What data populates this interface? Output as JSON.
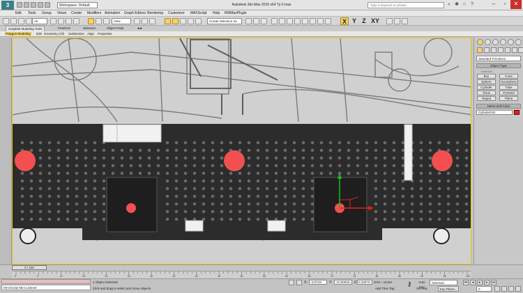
{
  "title_bar": {
    "logo_text": "3",
    "workspace": "Workspace: Default",
    "title": "Autodesk 3ds Max  2015 x64      Ty-2.max",
    "search_placeholder": "Type a keyword or phrase"
  },
  "menu": [
    "Edit",
    "Tools",
    "Group",
    "Views",
    "Create",
    "Modifiers",
    "Animation",
    "Graph Editors",
    "Rendering",
    "Customize",
    "MAXScript",
    "Help",
    "RWMaxPlugin"
  ],
  "toolbar": {
    "filter": "All",
    "refcoord": "View",
    "selection_set": "Create Selection Se",
    "axis": [
      "X",
      "Y",
      "Z",
      "XY"
    ]
  },
  "ribbon": {
    "tabs": [
      "Graphite Modeling Tools",
      "Freeform",
      "Selection",
      "Object Paint"
    ],
    "sub": [
      "Polygon Modeling",
      "Edit",
      "Geometry (All)",
      "Subdivision",
      "Align",
      "Properties"
    ]
  },
  "command_panel": {
    "category": "Standard Primitives",
    "object_type_header": "Object Type",
    "autogrid": "AutoGrid",
    "buttons": [
      "Box",
      "Cone",
      "Sphere",
      "GeoSphere",
      "Cylinder",
      "Tube",
      "Torus",
      "Pyramid",
      "Teapot",
      "Plane"
    ],
    "name_color_header": "Name and Color",
    "object_name": "Cylinder018",
    "object_color": "#e02020"
  },
  "time": {
    "slider": "0 / 100",
    "ticks": [
      "0",
      "5",
      "10",
      "15",
      "20",
      "25",
      "30",
      "35",
      "40",
      "45",
      "50",
      "55",
      "60",
      "65",
      "70",
      "75",
      "80",
      "85",
      "90",
      "95",
      "100"
    ]
  },
  "status": {
    "listener": "MAXScript Mini Listener",
    "selection": "1 Object Selected",
    "prompt": "Click and drag to select and move objects",
    "x_label": "X:",
    "x_value": "-3,874m",
    "y_label": "Y:",
    "y_value": "-10,0093m",
    "z_label": "Z:",
    "z_value": "0,3367m",
    "grid": "Grid = 10,0m",
    "add_time_tag": "Add Time Tag",
    "auto_key": "Auto Key",
    "set_key": "Set Key",
    "selected": "Selected",
    "key_filters": "Key Filters...",
    "frame": "0"
  },
  "colors": {
    "marker": "#f25050",
    "gizmo_y": "#1fb81f",
    "gizmo_x": "#e02020",
    "panel_dark": "#2c2c2c"
  }
}
